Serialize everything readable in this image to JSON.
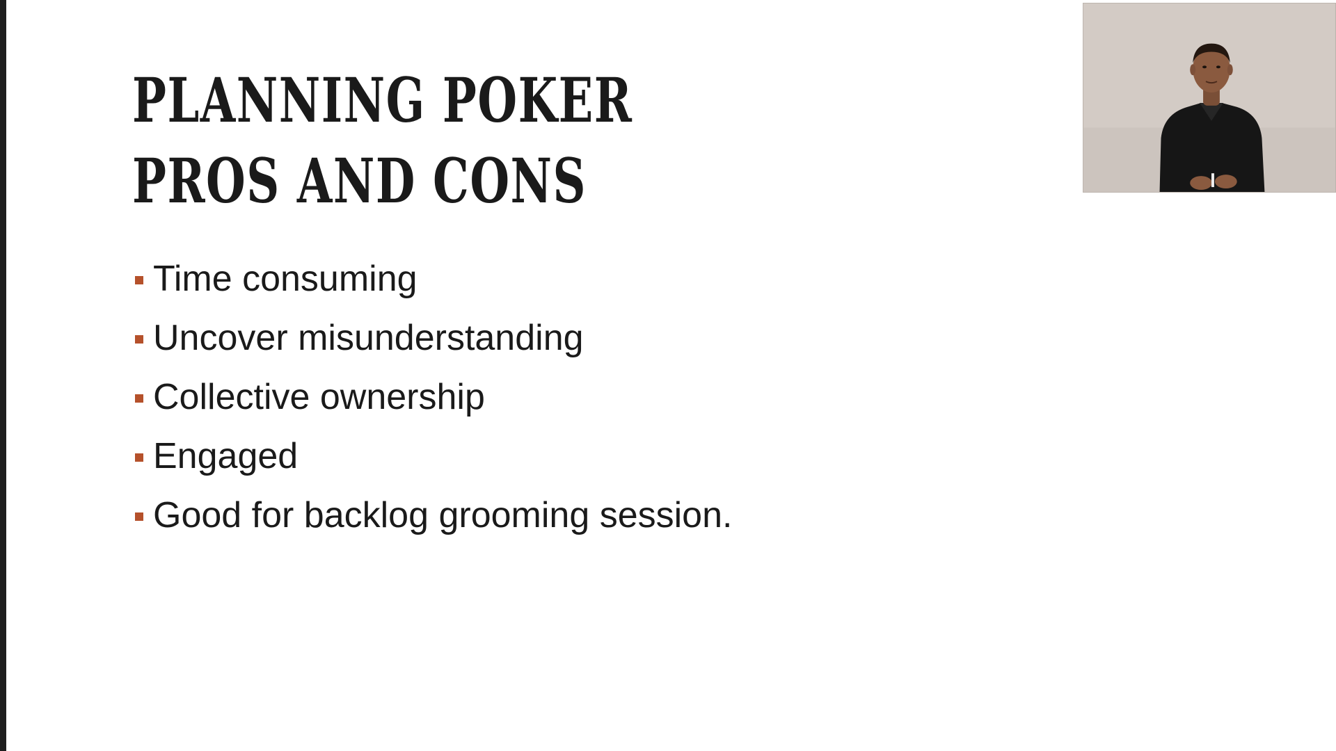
{
  "slide": {
    "title_lines": [
      "PLANNING POKER",
      "PROS AND CONS"
    ],
    "bullets": [
      "Time consuming",
      "Uncover misunderstanding",
      "Collective ownership",
      "Engaged",
      "Good for backlog grooming session."
    ]
  },
  "colors": {
    "bullet_accent": "#b5512b",
    "title_text": "#1a1a1a",
    "body_text": "#1a1a1a",
    "background": "#ffffff"
  }
}
